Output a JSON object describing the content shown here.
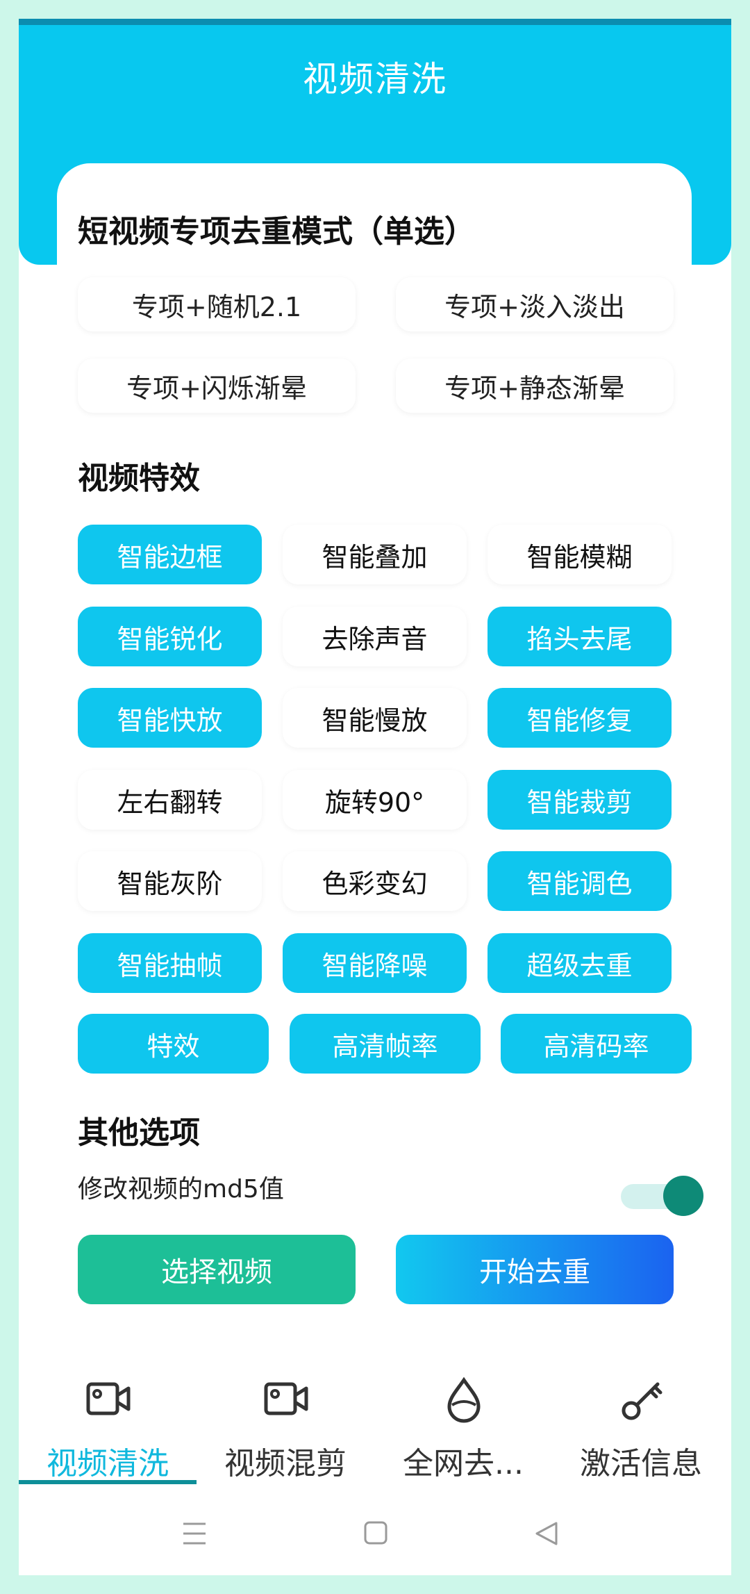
{
  "header": {
    "title": "视频清洗"
  },
  "mode_section": {
    "title": "短视频专项去重模式（单选）",
    "options": [
      {
        "label": "专项+随机2.1"
      },
      {
        "label": "专项+淡入淡出"
      },
      {
        "label": "专项+闪烁渐晕"
      },
      {
        "label": "专项+静态渐晕"
      }
    ]
  },
  "effects_section": {
    "title": "视频特效",
    "rows": [
      [
        {
          "label": "智能边框",
          "selected": true
        },
        {
          "label": "智能叠加",
          "selected": false
        },
        {
          "label": "智能模糊",
          "selected": false
        }
      ],
      [
        {
          "label": "智能锐化",
          "selected": true
        },
        {
          "label": "去除声音",
          "selected": false
        },
        {
          "label": "掐头去尾",
          "selected": true
        }
      ],
      [
        {
          "label": "智能快放",
          "selected": true
        },
        {
          "label": "智能慢放",
          "selected": false
        },
        {
          "label": "智能修复",
          "selected": true
        }
      ],
      [
        {
          "label": "左右翻转",
          "selected": false
        },
        {
          "label": "旋转90°",
          "selected": false
        },
        {
          "label": "智能裁剪",
          "selected": true
        }
      ],
      [
        {
          "label": "智能灰阶",
          "selected": false
        },
        {
          "label": "色彩变幻",
          "selected": false
        },
        {
          "label": "智能调色",
          "selected": true
        }
      ],
      [
        {
          "label": "智能抽帧",
          "selected": true
        },
        {
          "label": "智能降噪",
          "selected": true
        },
        {
          "label": "超级去重",
          "selected": true
        }
      ],
      [
        {
          "label": "特效",
          "selected": true
        },
        {
          "label": "高清帧率",
          "selected": true
        },
        {
          "label": "高清码率",
          "selected": true
        }
      ]
    ]
  },
  "other_section": {
    "title": "其他选项",
    "md5_label": "修改视频的md5值",
    "md5_enabled": true
  },
  "actions": {
    "select_video": "选择视频",
    "start_dedup": "开始去重"
  },
  "tabs": [
    {
      "label": "视频清洗",
      "icon": "video-camera-icon",
      "active": true
    },
    {
      "label": "视频混剪",
      "icon": "video-camera-icon",
      "active": false
    },
    {
      "label": "全网去...",
      "icon": "water-drop-icon",
      "active": false
    },
    {
      "label": "激活信息",
      "icon": "key-icon",
      "active": false
    }
  ],
  "colors": {
    "primary": "#08c8ef",
    "selected_effect": "#0fc6ee",
    "select_button": "#1dbf97",
    "toggle_on": "#0e8a77",
    "active_tab": "#10b8dd",
    "background": "#cdf7ea"
  }
}
